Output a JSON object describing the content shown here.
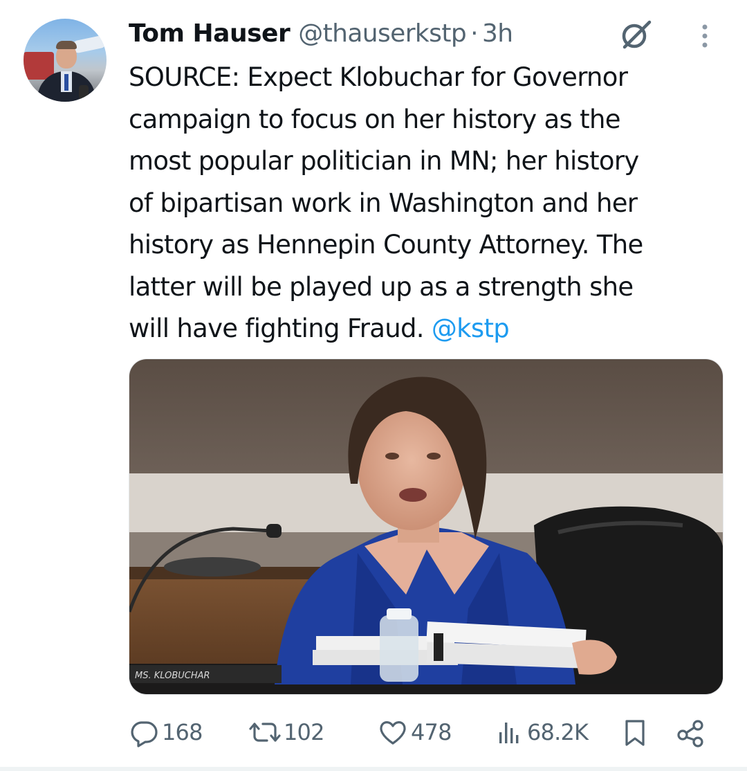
{
  "tweet": {
    "author_name": "Tom Hauser",
    "handle": "@thauserkstp",
    "separator": "·",
    "time": "3h",
    "text_lines": [
      "SOURCE: Expect Klobuchar for Governor",
      "campaign to focus on her history as the",
      "most popular politician in MN; her history",
      "of bipartisan work in Washington and her",
      "history as Hennepin County Attorney. The",
      "latter will be played up as a strength she",
      "will have fighting Fraud. "
    ],
    "mention": "@kstp",
    "media": {
      "nameplate_text": "MS. KLOBUCHAR"
    }
  },
  "actions": {
    "replies": "168",
    "reposts": "102",
    "likes": "478",
    "views": "68.2K"
  },
  "colors": {
    "text_primary": "#0f1419",
    "text_secondary": "#536471",
    "link": "#1d9bf0",
    "jacket_blue": "#1f3fa0"
  },
  "icons": {
    "grok": "grok-icon",
    "more": "more-vertical-icon",
    "reply": "reply-icon",
    "repost": "repost-icon",
    "like": "heart-icon",
    "views": "analytics-icon",
    "bookmark": "bookmark-icon",
    "share": "share-icon"
  }
}
